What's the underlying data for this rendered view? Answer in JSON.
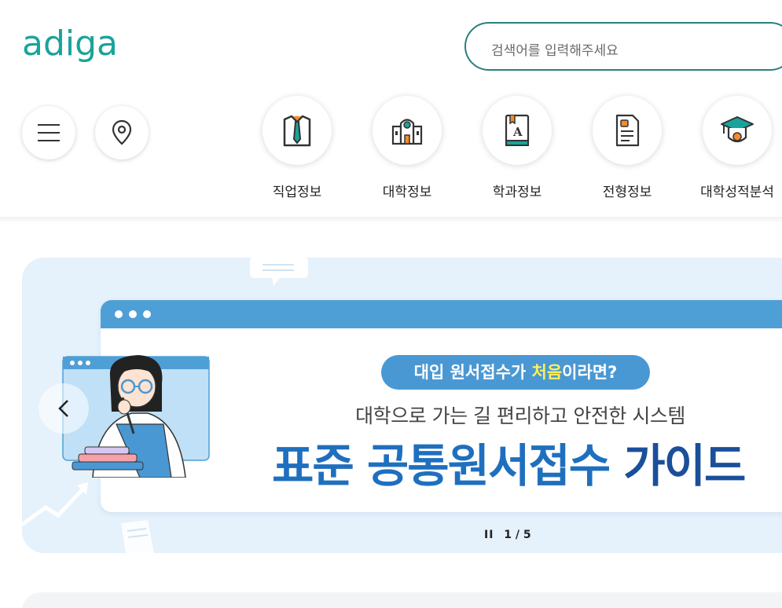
{
  "brand": {
    "logo_text": "adiga",
    "logo_color": "#1aa39a"
  },
  "search": {
    "placeholder": "검색어를 입력해주세요"
  },
  "toolbar": {
    "menu_icon": "hamburger-menu-icon",
    "location_icon": "location-pin-icon"
  },
  "nav": [
    {
      "label": "직업정보",
      "icon": "shirt-tie-icon"
    },
    {
      "label": "대학정보",
      "icon": "university-building-icon"
    },
    {
      "label": "학과정보",
      "icon": "book-icon"
    },
    {
      "label": "전형정보",
      "icon": "document-icon"
    },
    {
      "label": "대학성적분석",
      "icon": "graduation-cap-icon"
    }
  ],
  "banner": {
    "pill_prefix": "대입 원서접수가 ",
    "pill_highlight": "처음",
    "pill_suffix": "이라면?",
    "subtitle": "대학으로 가는 길 편리하고 안전한 시스템",
    "headline_main": "표준 공통원서접수 ",
    "headline_strong": "가이드",
    "pager": {
      "current": "1",
      "total": "5",
      "separator": "/"
    },
    "pause_symbol": "II"
  },
  "colors": {
    "accent": "#2a7f7f",
    "banner_bg": "#e5f1fb",
    "window_bar": "#4f9fd7",
    "headline": "#1f6fbf"
  }
}
